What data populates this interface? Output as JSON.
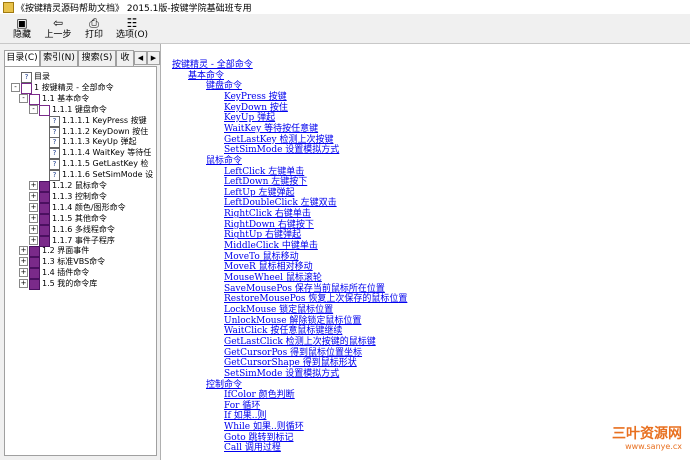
{
  "window": {
    "title": "《按键精灵源码帮助文档》 2015.1版-按键学院基础班专用"
  },
  "toolbar": {
    "buttons": [
      {
        "label": "隐藏",
        "icon": "hide-icon"
      },
      {
        "label": "上一步",
        "icon": "back-arrow-icon"
      },
      {
        "label": "打印",
        "icon": "print-icon"
      },
      {
        "label": "选项(O)",
        "icon": "options-icon"
      }
    ]
  },
  "sidebar": {
    "tabs": [
      "目录(C)",
      "索引(N)",
      "搜索(S)",
      "收"
    ],
    "tree": [
      {
        "label": "目录",
        "icon": "page"
      },
      {
        "label": "1 按键精灵 - 全部命令",
        "icon": "bookopen",
        "exp": "-"
      },
      {
        "label": "1.1 基本命令",
        "icon": "bookopen",
        "exp": "-"
      },
      {
        "label": "1.1.1 键盘命令",
        "icon": "bookopen",
        "exp": "-"
      },
      {
        "label": "1.1.1.1 KeyPress 按键",
        "icon": "page"
      },
      {
        "label": "1.1.1.2 KeyDown 按住",
        "icon": "page"
      },
      {
        "label": "1.1.1.3 KeyUp 弹起",
        "icon": "page"
      },
      {
        "label": "1.1.1.4 WaitKey 等待任",
        "icon": "page"
      },
      {
        "label": "1.1.1.5 GetLastKey 检",
        "icon": "page"
      },
      {
        "label": "1.1.1.6 SetSimMode 设",
        "icon": "page"
      },
      {
        "label": "1.1.2 鼠标命令",
        "icon": "book",
        "exp": "+"
      },
      {
        "label": "1.1.3 控制命令",
        "icon": "book",
        "exp": "+"
      },
      {
        "label": "1.1.4 颜色/图形命令",
        "icon": "book",
        "exp": "+"
      },
      {
        "label": "1.1.5 其他命令",
        "icon": "book",
        "exp": "+"
      },
      {
        "label": "1.1.6 多线程命令",
        "icon": "book",
        "exp": "+"
      },
      {
        "label": "1.1.7 事件子程序",
        "icon": "book",
        "exp": "+"
      },
      {
        "label": "1.2 界面事件",
        "icon": "book",
        "exp": "+"
      },
      {
        "label": "1.3 标准VBS命令",
        "icon": "book",
        "exp": "+"
      },
      {
        "label": "1.4 插件命令",
        "icon": "book",
        "exp": "+"
      },
      {
        "label": "1.5 我的命令库",
        "icon": "book",
        "exp": "+"
      }
    ]
  },
  "content": {
    "links": [
      "按键精灵 - 全部命令",
      "基本命令",
      "键盘命令",
      "KeyPress 按键",
      "KeyDown 按住",
      "KeyUp 弹起",
      "WaitKey 等待按任意键",
      "GetLastKey 检测上次按键",
      "SetSimMode 设置模拟方式",
      "鼠标命令",
      "LeftClick 左键单击",
      "LeftDown 左键按下",
      "LeftUp 左键弹起",
      "LeftDoubleClick 左键双击",
      "RightClick 右键单击",
      "RightDown 右键按下",
      "RightUp 右键弹起",
      "MiddleClick 中键单击",
      "MoveTo 鼠标移动",
      "MoveR 鼠标相对移动",
      "MouseWheel 鼠标滚轮",
      "SaveMousePos 保存当前鼠标所在位置",
      "RestoreMousePos 恢复上次保存的鼠标位置",
      "LockMouse 锁定鼠标位置",
      "UnlockMouse 解除锁定鼠标位置",
      "WaitClick 按任意鼠标键继续",
      "GetLastClick 检测上次按键的鼠标键",
      "GetCursorPos 得到鼠标位置坐标",
      "GetCursorShape 得到鼠标形状",
      "SetSimMode 设置模拟方式",
      "控制命令",
      "IfColor 颜色判断",
      "For 循环",
      "If 如果..则",
      "While 如果..则循环",
      "Goto 跳转到标记",
      "Call 调用过程"
    ]
  },
  "watermark": {
    "brand": "三叶资源网",
    "url": "www.sanye.cx"
  }
}
